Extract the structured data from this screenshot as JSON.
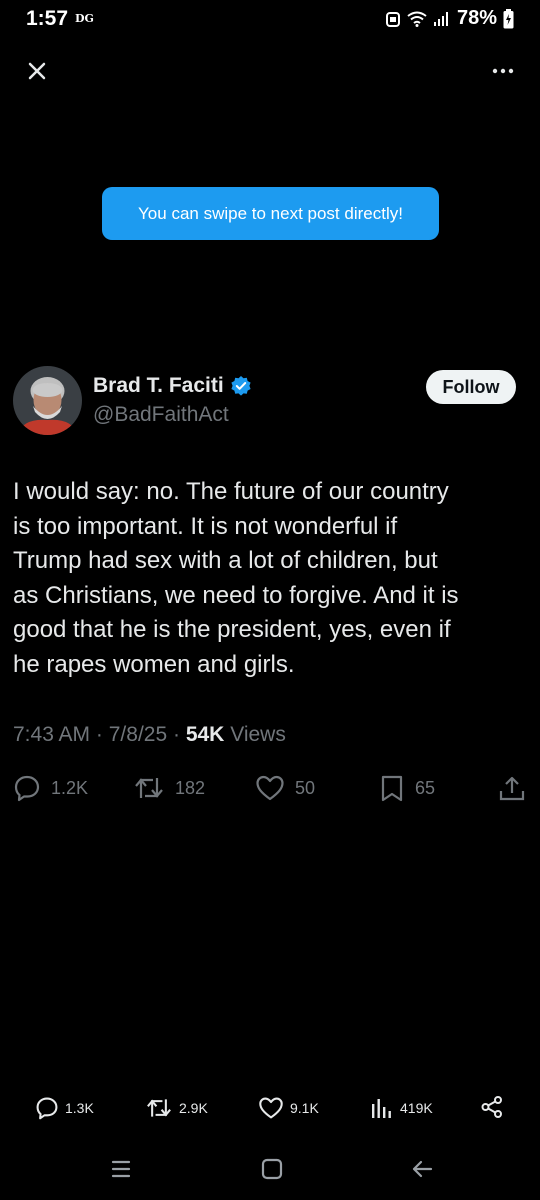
{
  "status_bar": {
    "time": "1:57",
    "carrier": "DG",
    "battery": "78%"
  },
  "toast": {
    "text": "You can swipe to next post directly!"
  },
  "author": {
    "name": "Brad T. Faciti",
    "handle": "@BadFaithAct",
    "verified": true
  },
  "follow_label": "Follow",
  "post": {
    "text": "I would say: no. The future of our country\nis too important. It is not wonderful if\nTrump had sex with a lot of children, but\nas Christians, we need to forgive. And it is\ngood that he is the president, yes, even if\nhe rapes women and girls.",
    "time": "7:43 AM",
    "date": "7/8/25",
    "separator": "·",
    "views_count": "54K",
    "views_label": "Views"
  },
  "actions": {
    "replies": "1.2K",
    "reposts": "182",
    "likes": "50",
    "bookmarks": "65"
  },
  "bottom_bar": {
    "replies": "1.3K",
    "reposts": "2.9K",
    "likes": "9.1K",
    "views": "419K"
  },
  "icons": {
    "close": "close-icon",
    "more": "more-icon",
    "verified": "verified-badge-icon",
    "reply": "reply-icon",
    "repost": "repost-icon",
    "like": "heart-icon",
    "bookmark": "bookmark-icon",
    "share": "share-icon",
    "views": "views-icon",
    "share_alt": "share-nodes-icon",
    "nav_recents": "recents-icon",
    "nav_home": "home-icon",
    "nav_back": "back-icon"
  },
  "colors": {
    "background": "#000000",
    "accent": "#1d9bf0",
    "text_primary": "#e7e9ea",
    "text_secondary": "#71767b"
  }
}
